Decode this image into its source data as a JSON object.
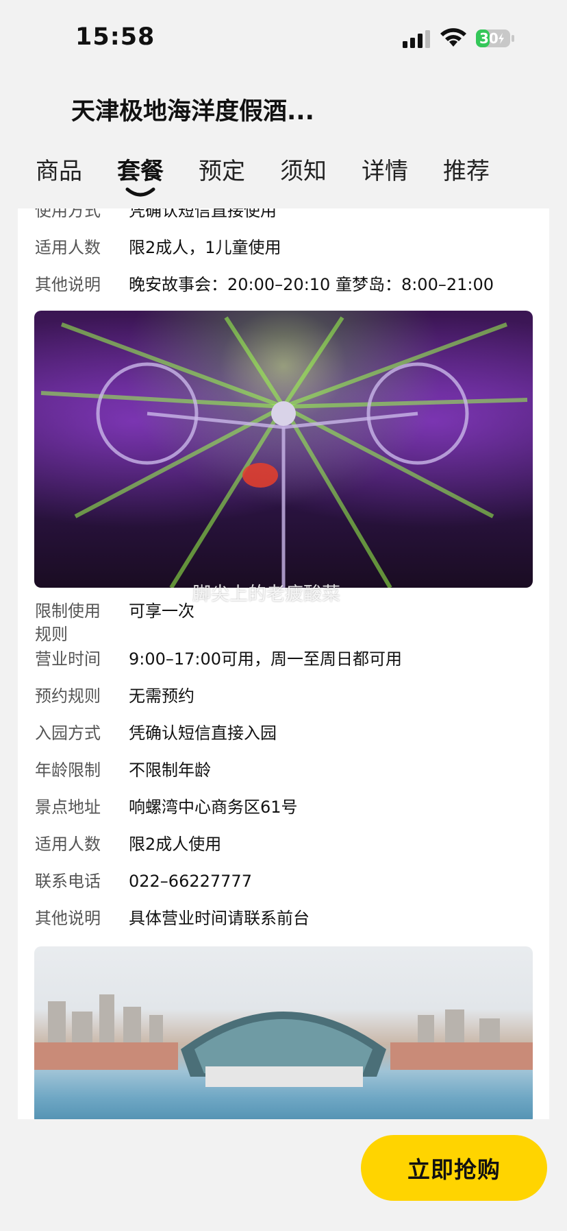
{
  "status_bar": {
    "time": "15:58",
    "battery": "30"
  },
  "header": {
    "title": "天津极地海洋度假酒..."
  },
  "tabs": [
    {
      "label": "商品",
      "active": false
    },
    {
      "label": "套餐",
      "active": true
    },
    {
      "label": "预定",
      "active": false
    },
    {
      "label": "须知",
      "active": false
    },
    {
      "label": "详情",
      "active": false
    },
    {
      "label": "推荐",
      "active": false
    }
  ],
  "package_a": {
    "rows": [
      {
        "key": "使用方式",
        "value": "凭确认短信直接使用"
      },
      {
        "key": "适用人数",
        "value": "限2成人，1儿童使用"
      },
      {
        "key": "其他说明",
        "value": "晚安故事会：20:00–20:10 童梦岛：8:00–21:00"
      }
    ]
  },
  "image1": {
    "watermark": "脚尖上的老疲酸菜"
  },
  "package_b": {
    "rows": [
      {
        "key": "限制使用规则",
        "value": "可享一次"
      },
      {
        "key": "营业时间",
        "value": "9:00–17:00可用，周一至周日都可用"
      },
      {
        "key": "预约规则",
        "value": "无需预约"
      },
      {
        "key": "入园方式",
        "value": "凭确认短信直接入园"
      },
      {
        "key": "年龄限制",
        "value": "不限制年龄"
      },
      {
        "key": "景点地址",
        "value": "响螺湾中心商务区61号"
      },
      {
        "key": "适用人数",
        "value": "限2成人使用"
      },
      {
        "key": "联系电话",
        "value": "022–66227777"
      },
      {
        "key": "其他说明",
        "value": "具体营业时间请联系前台"
      }
    ]
  },
  "buy_button": {
    "label": "立即抢购"
  },
  "colors": {
    "accent": "#ffd400",
    "background": "#f2f2f2",
    "card": "#ffffff"
  }
}
